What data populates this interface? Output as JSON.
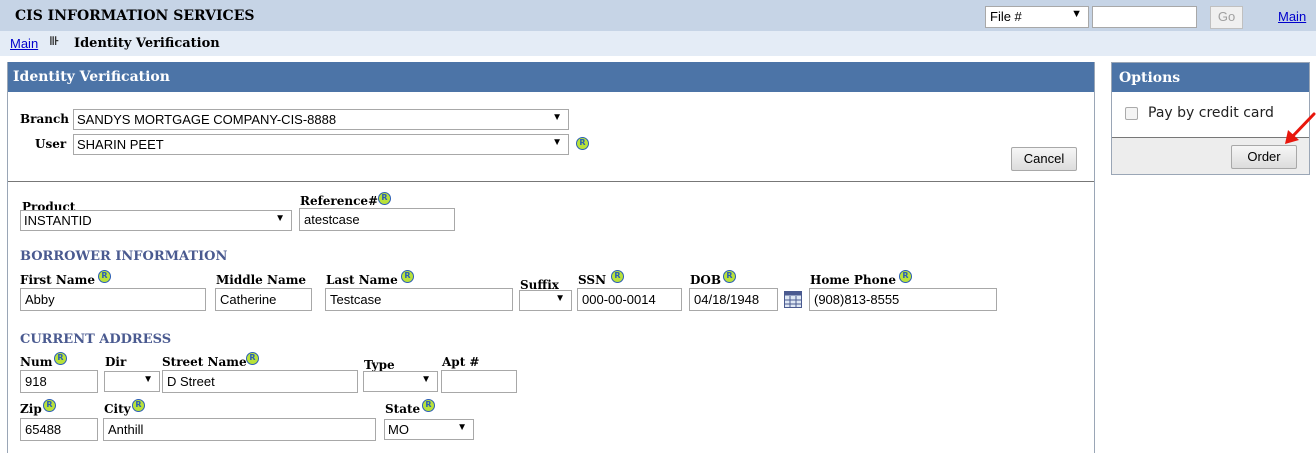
{
  "header": {
    "app_title": "CIS INFORMATION SERVICES",
    "file_select_value": "File #",
    "search_value": "",
    "go_label": "Go",
    "main_link": "Main"
  },
  "breadcrumb": {
    "main_link": "Main",
    "separator": "⊪",
    "current": "Identity Verification"
  },
  "panel": {
    "title": "Identity Verification",
    "branch_label": "Branch",
    "branch_value": "SANDYS MORTGAGE COMPANY-CIS-8888",
    "user_label": "User",
    "user_value": "SHARIN PEET",
    "cancel_label": "Cancel"
  },
  "order": {
    "product_label": "Product",
    "product_value": "INSTANTID",
    "reference_label": "Reference#",
    "reference_value": "atestcase"
  },
  "borrower": {
    "section_title": "BORROWER INFORMATION",
    "first_name_label": "First Name",
    "first_name_value": "Abby",
    "middle_name_label": "Middle Name",
    "middle_name_value": "Catherine",
    "last_name_label": "Last Name",
    "last_name_value": "Testcase",
    "suffix_label": "Suffix",
    "suffix_value": "",
    "ssn_label": "SSN",
    "ssn_value": "000-00-0014",
    "dob_label": "DOB",
    "dob_value": "04/18/1948",
    "home_phone_label": "Home Phone",
    "home_phone_value": "(908)813-8555"
  },
  "address": {
    "section_title": "CURRENT ADDRESS",
    "num_label": "Num",
    "num_value": "918",
    "dir_label": "Dir",
    "dir_value": "",
    "street_label": "Street Name",
    "street_value": "D Street",
    "type_label": "Type",
    "type_value": "",
    "apt_label": "Apt #",
    "apt_value": "",
    "zip_label": "Zip",
    "zip_value": "65488",
    "city_label": "City",
    "city_value": "Anthill",
    "state_label": "State",
    "state_value": "MO"
  },
  "options": {
    "title": "Options",
    "pay_by_card_label": "Pay by credit card",
    "pay_by_card_checked": false,
    "order_label": "Order"
  },
  "icons": {
    "help": "R",
    "dropdown": "▼"
  },
  "colors": {
    "header_bar": "#c6d4e6",
    "breadcrumb_bar": "#e4ecf6",
    "panel_header": "#4c74a7",
    "section_title": "#4a5a90",
    "help_icon_fill": "#b9e23a",
    "annotation_arrow": "#e8160c"
  }
}
